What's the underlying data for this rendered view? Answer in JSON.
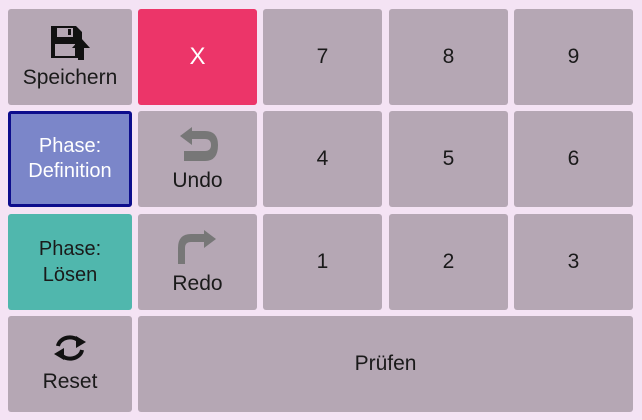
{
  "controls": {
    "save_label": "Speichern",
    "clear_label": "X",
    "phase_definition": {
      "line1": "Phase:",
      "line2": "Definition"
    },
    "phase_solve": {
      "line1": "Phase:",
      "line2": "Lösen"
    },
    "undo_label": "Undo",
    "redo_label": "Redo",
    "reset_label": "Reset",
    "check_label": "Prüfen"
  },
  "keypad": {
    "digits": [
      "7",
      "8",
      "9",
      "4",
      "5",
      "6",
      "1",
      "2",
      "3"
    ]
  },
  "icons": {
    "save": "floppy-disk-upload-icon",
    "undo": "undo-arrow-icon",
    "redo": "redo-arrow-icon",
    "reset": "refresh-icon"
  },
  "colors": {
    "background": "#f4e3f4",
    "button": "#b5a7b4",
    "clear": "#ec3569",
    "phase_definition": "#7b86c9",
    "phase_definition_border": "#0d0d8c",
    "phase_solve": "#50b7ad"
  }
}
